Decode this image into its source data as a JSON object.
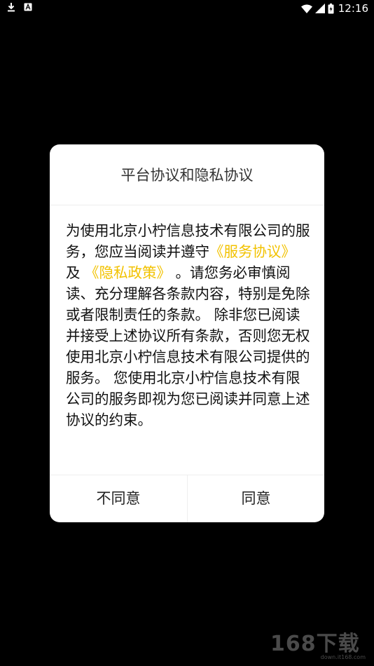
{
  "status_bar": {
    "left_icons": [
      "download-icon",
      "a-notification-icon"
    ],
    "right_icons": [
      "wifi-icon",
      "signal-icon",
      "battery-icon"
    ],
    "time": "12:16"
  },
  "dialog": {
    "title": "平台协议和隐私协议",
    "body": {
      "part1": "为使用北京小柠信息技术有限公司的服务，您应当阅读并遵守",
      "link_service": "《服务协议》",
      "and": " 及 ",
      "link_privacy": "《隐私政策》",
      "part2": " 。请您务必审慎阅读、充分理解各条款内容，特别是免除或者限制责任的条款。 除非您已阅读并接受上述协议所有条款，否则您无权使用北京小柠信息技术有限公司提供的服务。 您使用北京小柠信息技术有限公司的服务即视为您已阅读并同意上述协议的约束。"
    },
    "buttons": {
      "disagree": "不同意",
      "agree": "同意"
    }
  },
  "watermark": {
    "main": "168下载",
    "sub": "down.it168.com"
  },
  "colors": {
    "background": "#000000",
    "dialog": "#ffffff",
    "link": "#f2c200"
  }
}
